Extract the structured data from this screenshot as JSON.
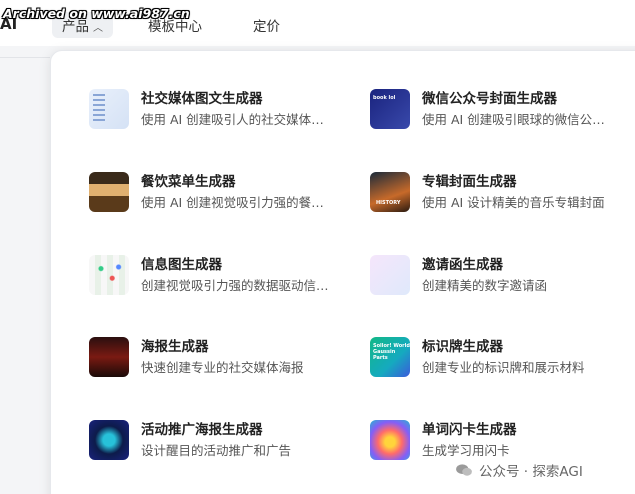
{
  "watermark_top": "Archived on www.ai987.cn",
  "logo_fragment": "AI",
  "nav": {
    "products": "产品",
    "templates": "模板中心",
    "pricing": "定价"
  },
  "cards": [
    {
      "title": "社交媒体图文生成器",
      "desc": "使用 AI 创建吸引人的社交媒体图文内容",
      "icon": "social-media-thumb"
    },
    {
      "title": "微信公众号封面生成器",
      "desc": "使用 AI 创建吸引眼球的微信公众号封面",
      "icon": "wechat-cover-thumb"
    },
    {
      "title": "餐饮菜单生成器",
      "desc": "使用 AI 创建视觉吸引力强的餐饮菜单",
      "icon": "menu-thumb"
    },
    {
      "title": "专辑封面生成器",
      "desc": "使用 AI 设计精美的音乐专辑封面",
      "icon": "album-cover-thumb"
    },
    {
      "title": "信息图生成器",
      "desc": "创建视觉吸引力强的数据驱动信息图",
      "icon": "infographic-thumb"
    },
    {
      "title": "邀请函生成器",
      "desc": "创建精美的数字邀请函",
      "icon": "invitation-thumb"
    },
    {
      "title": "海报生成器",
      "desc": "快速创建专业的社交媒体海报",
      "icon": "poster-thumb"
    },
    {
      "title": "标识牌生成器",
      "desc": "创建专业的标识牌和展示材料",
      "icon": "sign-thumb"
    },
    {
      "title": "活动推广海报生成器",
      "desc": "设计醒目的活动推广和广告",
      "icon": "event-poster-thumb"
    },
    {
      "title": "单词闪卡生成器",
      "desc": "生成学习用闪卡",
      "icon": "flashcard-thumb"
    }
  ],
  "thumb_text": {
    "wechat": "book lol",
    "album": "HISTORY",
    "sign": "Sollor! World Gaussin Parts"
  },
  "bottom_watermark": "公众号 · 探索AGI"
}
